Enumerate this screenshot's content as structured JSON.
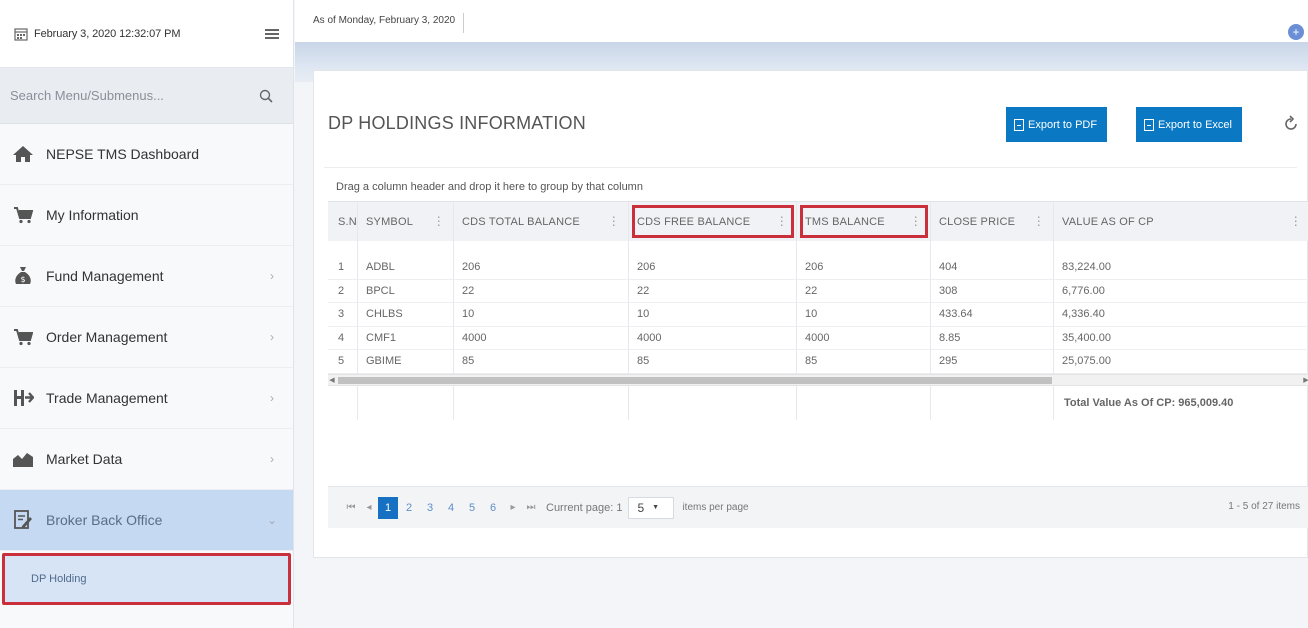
{
  "sidebar": {
    "datetime": "February 3, 2020 12:32:07 PM",
    "search_placeholder": "Search Menu/Submenus...",
    "items": [
      {
        "label": "NEPSE TMS Dashboard",
        "icon": "home-icon",
        "chevron": ""
      },
      {
        "label": "My Information",
        "icon": "cart-icon",
        "chevron": ""
      },
      {
        "label": "Fund Management",
        "icon": "money-bag-icon",
        "chevron": "›"
      },
      {
        "label": "Order Management",
        "icon": "cart-icon",
        "chevron": "›"
      },
      {
        "label": "Trade Management",
        "icon": "trade-icon",
        "chevron": "›"
      },
      {
        "label": "Market Data",
        "icon": "chart-icon",
        "chevron": "›"
      },
      {
        "label": "Broker Back Office",
        "icon": "edit-doc-icon",
        "chevron": "⌄"
      }
    ],
    "submenu": {
      "label": "DP Holding"
    }
  },
  "topbar": {
    "as_of": "As of Monday, February 3, 2020",
    "plus": "+"
  },
  "card": {
    "title": "DP HOLDINGS INFORMATION",
    "export_pdf": "Export to PDF",
    "export_excel": "Export to Excel",
    "group_hint": "Drag a column header and drop it here to group by that column"
  },
  "table": {
    "columns": [
      "S.N",
      "SYMBOL",
      "CDS TOTAL BALANCE",
      "CDS FREE BALANCE",
      "TMS BALANCE",
      "CLOSE PRICE",
      "VALUE AS OF CP"
    ],
    "rows": [
      [
        "1",
        "ADBL",
        "206",
        "206",
        "206",
        "404",
        "83,224.00"
      ],
      [
        "2",
        "BPCL",
        "22",
        "22",
        "22",
        "308",
        "6,776.00"
      ],
      [
        "3",
        "CHLBS",
        "10",
        "10",
        "10",
        "433.64",
        "4,336.40"
      ],
      [
        "4",
        "CMF1",
        "4000",
        "4000",
        "4000",
        "8.85",
        "35,400.00"
      ],
      [
        "5",
        "GBIME",
        "85",
        "85",
        "85",
        "295",
        "25,075.00"
      ]
    ],
    "total": "Total Value As Of CP: 965,009.40"
  },
  "pager": {
    "first": "⏮",
    "prev": "◂",
    "pages": [
      "1",
      "2",
      "3",
      "4",
      "5",
      "6"
    ],
    "current_page": "1",
    "next": "▸",
    "last": "⏭",
    "current_label": "Current page: 1",
    "page_size": "5",
    "items_per_page": "items per page",
    "range": "1 - 5 of 27 items"
  },
  "colors": {
    "accent": "#0a78c2",
    "highlight": "#c9303c",
    "active_menu": "#c5d9f3"
  }
}
